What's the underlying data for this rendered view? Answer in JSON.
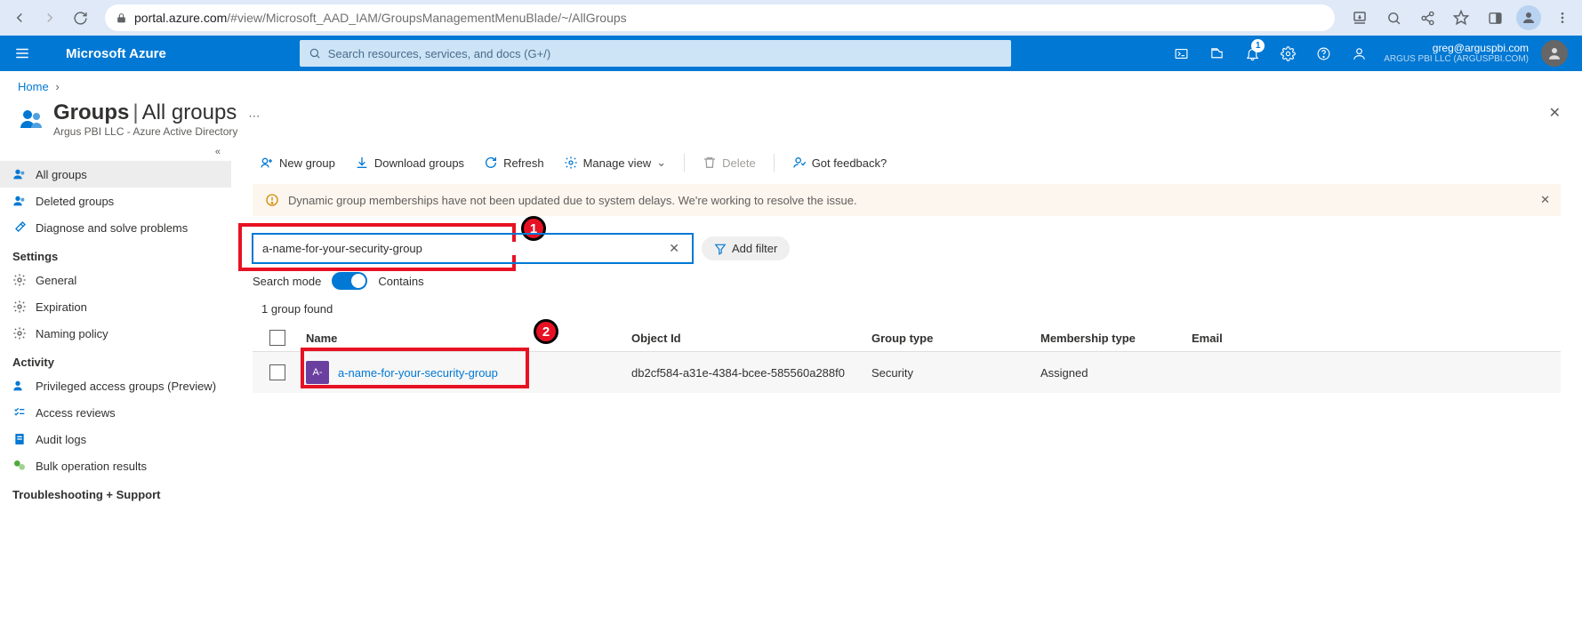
{
  "browser": {
    "url_domain": "portal.azure.com",
    "url_path": "/#view/Microsoft_AAD_IAM/GroupsManagementMenuBlade/~/AllGroups"
  },
  "header": {
    "brand": "Microsoft Azure",
    "search_placeholder": "Search resources, services, and docs (G+/)",
    "notification_count": "1",
    "user_email": "greg@arguspbi.com",
    "user_tenant": "ARGUS PBI LLC (ARGUSPBI.COM)"
  },
  "breadcrumb": {
    "home": "Home"
  },
  "page": {
    "title_main": "Groups",
    "title_sub": "All groups",
    "subtitle": "Argus PBI LLC - Azure Active Directory"
  },
  "sidebar": {
    "items": [
      {
        "label": "All groups"
      },
      {
        "label": "Deleted groups"
      },
      {
        "label": "Diagnose and solve problems"
      }
    ],
    "section_settings": "Settings",
    "settings": [
      {
        "label": "General"
      },
      {
        "label": "Expiration"
      },
      {
        "label": "Naming policy"
      }
    ],
    "section_activity": "Activity",
    "activity": [
      {
        "label": "Privileged access groups (Preview)"
      },
      {
        "label": "Access reviews"
      },
      {
        "label": "Audit logs"
      },
      {
        "label": "Bulk operation results"
      }
    ],
    "section_troubleshoot": "Troubleshooting + Support"
  },
  "toolbar": {
    "new_group": "New group",
    "download": "Download groups",
    "refresh": "Refresh",
    "manage_view": "Manage view",
    "delete": "Delete",
    "feedback": "Got feedback?"
  },
  "alert": {
    "text": "Dynamic group memberships have not been updated due to system delays. We're working to resolve the issue."
  },
  "filter": {
    "search_value": "a-name-for-your-security-group",
    "add_filter": "Add filter",
    "search_mode_label": "Search mode",
    "search_mode_value": "Contains",
    "result_count": "1 group found"
  },
  "table": {
    "headers": {
      "name": "Name",
      "object_id": "Object Id",
      "group_type": "Group type",
      "membership_type": "Membership type",
      "email": "Email"
    },
    "rows": [
      {
        "avatar": "A-",
        "name": "a-name-for-your-security-group",
        "object_id": "db2cf584-a31e-4384-bcee-585560a288f0",
        "group_type": "Security",
        "membership_type": "Assigned",
        "email": ""
      }
    ]
  },
  "annotations": {
    "n1": "1",
    "n2": "2"
  }
}
